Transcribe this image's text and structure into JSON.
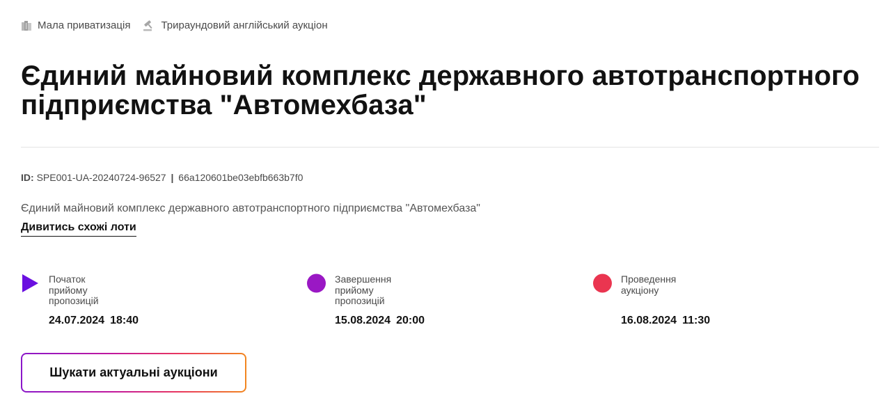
{
  "tags": {
    "privatization": {
      "label": "Мала приватизація",
      "icon": "building-icon"
    },
    "auction_type": {
      "label": "Трираундовий англійський аукціон",
      "icon": "gavel-icon"
    }
  },
  "title": "Єдиний майновий комплекс державного автотранспортного підприємства \"Автомехбаза\"",
  "identifier": {
    "label": "ID:",
    "code": "SPE001-UA-20240724-96527",
    "separator": "|",
    "hash": "66a120601be03ebfb663b7f0"
  },
  "description": "Єдиний майновий комплекс державного автотранспортного підприємства \"Автомехбаза\"",
  "similar_link": "Дивитись схожі лоти",
  "timeline": [
    {
      "label": "Початок прийому пропозицій",
      "date": "24.07.2024",
      "time": "18:40",
      "marker": "play-icon",
      "color": "#6a0fe0"
    },
    {
      "label": "Завершення прийому пропозицій",
      "date": "15.08.2024",
      "time": "20:00",
      "marker": "circle-icon",
      "color": "#9a18c4"
    },
    {
      "label": "Проведення аукціону",
      "date": "16.08.2024",
      "time": "11:30",
      "marker": "circle-icon",
      "color": "#ea3550"
    }
  ],
  "search_button": "Шукати актуальні аукціони",
  "colors": {
    "accent_gradient": [
      "#8a17c9",
      "#c0189e",
      "#e8365f",
      "#f2861f"
    ],
    "text": "#121212",
    "muted": "#4a4a4a"
  }
}
